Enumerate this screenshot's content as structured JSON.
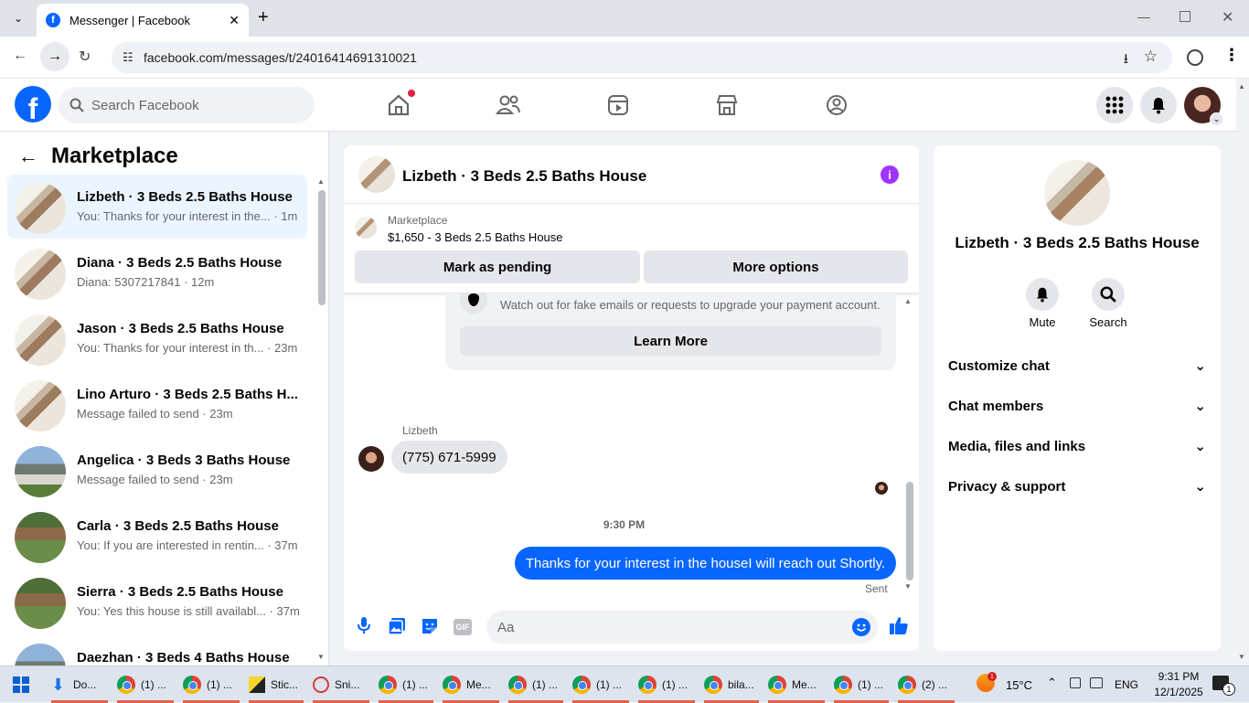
{
  "browser": {
    "tab_title": "Messenger | Facebook",
    "url": "facebook.com/messages/t/24016414691310021"
  },
  "fbnav": {
    "logo": "f",
    "search_placeholder": "Search Facebook"
  },
  "sidebar": {
    "title": "Marketplace",
    "conversations": [
      {
        "name": "Lizbeth · 3 Beds 2.5 Baths House",
        "preview": "You: Thanks for your interest in the... · 1m",
        "thumb": "house-interior"
      },
      {
        "name": "Diana · 3 Beds 2.5 Baths House",
        "preview": "Diana: 5307217841 · 12m",
        "thumb": "house-interior"
      },
      {
        "name": "Jason · 3 Beds 2.5 Baths House",
        "preview": "You: Thanks for your interest in th... · 23m",
        "thumb": "house-interior"
      },
      {
        "name": "Lino Arturo · 3 Beds 2.5 Baths H...",
        "preview": "Message failed to send · 23m",
        "thumb": "house-interior"
      },
      {
        "name": "Angelica · 3 Beds 3 Baths House",
        "preview": "Message failed to send · 23m",
        "thumb": "house-exterior"
      },
      {
        "name": "Carla · 3 Beds 2.5 Baths House",
        "preview": "You: If you are interested in rentin... · 37m",
        "thumb": "house-yard"
      },
      {
        "name": "Sierra · 3 Beds 2.5 Baths House",
        "preview": "You: Yes this house is still availabl... · 37m",
        "thumb": "house-yard"
      },
      {
        "name": "Daezhan · 3 Beds 4 Baths House",
        "preview": "",
        "thumb": "house-exterior"
      }
    ]
  },
  "chat": {
    "title": "Lizbeth · 3 Beds 2.5 Baths House",
    "marketplace_label": "Marketplace",
    "listing": "$1,650 - 3 Beds 2.5 Baths House",
    "mark_pending": "Mark as pending",
    "more_options": "More options",
    "warning_text": "Watch out for fake emails or requests to upgrade your payment account.",
    "learn_more": "Learn More",
    "sender_name": "Lizbeth",
    "incoming_message": "(775) 671-5999",
    "timestamp": "9:30 PM",
    "outgoing_message": "Thanks for your interest in the houseI will reach out Shortly.",
    "sent_status": "Sent",
    "composer_placeholder": "Aa",
    "gif_label": "GIF"
  },
  "details": {
    "name": "Lizbeth · 3 Beds 2.5 Baths House",
    "mute": "Mute",
    "search": "Search",
    "sections": [
      "Customize chat",
      "Chat members",
      "Media, files and links",
      "Privacy & support"
    ]
  },
  "taskbar": {
    "items": [
      "Do...",
      "(1) ...",
      "(1) ...",
      "Stic...",
      "Sni...",
      "(1) ...",
      "Me...",
      "(1) ...",
      "(1) ...",
      "(1) ...",
      "bila...",
      "Me...",
      "(1) ...",
      "(2) ..."
    ],
    "weather": "15°C",
    "lang": "ENG",
    "time": "9:31 PM",
    "date": "12/1/2025",
    "notif_count": "1"
  },
  "colors": {
    "accent": "#0866ff",
    "messenger_purple": "#a033ff",
    "taskbar_bg": "#dde4ee"
  }
}
